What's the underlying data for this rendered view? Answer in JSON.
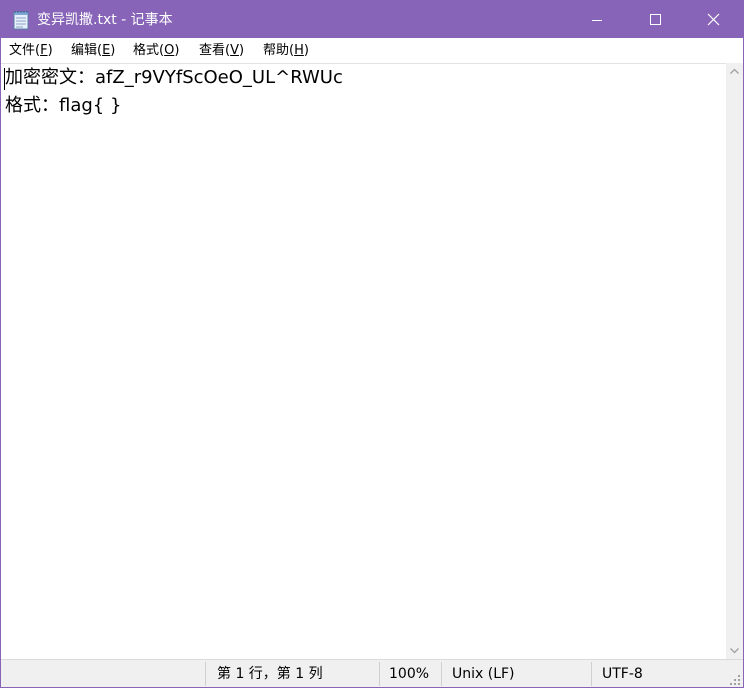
{
  "window": {
    "title": "变异凯撒.txt - 记事本",
    "accent_color": "#8764b8",
    "buttons": {
      "minimize_icon": "minimize-icon",
      "maximize_icon": "maximize-icon",
      "close_icon": "close-icon"
    }
  },
  "menu": {
    "items": [
      {
        "label": "文件(",
        "mnemonic": "F",
        "suffix": ")"
      },
      {
        "label": "编辑(",
        "mnemonic": "E",
        "suffix": ")"
      },
      {
        "label": "格式(",
        "mnemonic": "O",
        "suffix": ")"
      },
      {
        "label": "查看(",
        "mnemonic": "V",
        "suffix": ")"
      },
      {
        "label": "帮助(",
        "mnemonic": "H",
        "suffix": ")"
      }
    ]
  },
  "document": {
    "lines": [
      "加密密文：afZ_r9VYfScOeO_UL^RWUc",
      "格式：flag{ }"
    ]
  },
  "status": {
    "position": "第 1 行，第 1 列",
    "zoom": "100%",
    "line_ending": "Unix (LF)",
    "encoding": "UTF-8"
  }
}
